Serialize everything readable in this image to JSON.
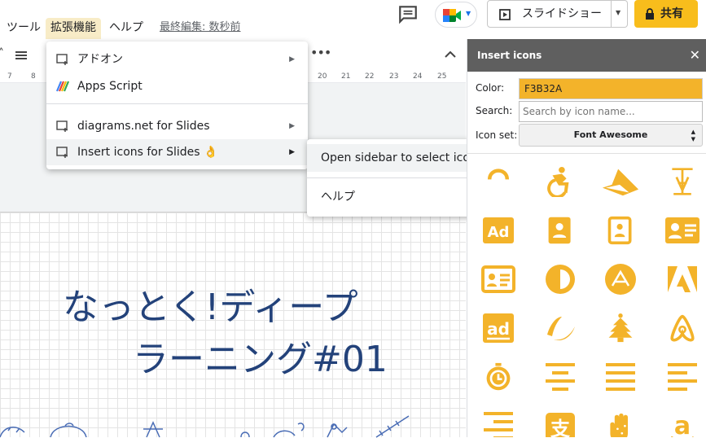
{
  "menubar": {
    "items": [
      "ツール",
      "拡張機能",
      "ヘルプ"
    ],
    "last_edit": "最終編集: 数秒前",
    "slideshow_label": "スライドショー",
    "share_label": "共有"
  },
  "ruler": {
    "numbers": [
      "7",
      "8",
      "20",
      "21",
      "22",
      "23",
      "24",
      "25"
    ]
  },
  "slide": {
    "title_line1": "なっとく!ディープ",
    "title_line2": "ラーニング#01"
  },
  "extensions_menu": {
    "items": [
      {
        "label": "アドオン",
        "has_submenu": true
      },
      {
        "label": "Apps Script",
        "has_submenu": false
      },
      {
        "label": "diagrams.net for Slides",
        "has_submenu": true
      },
      {
        "label": "Insert icons for Slides 👌",
        "has_submenu": true
      }
    ],
    "submenu_arrow": "▶"
  },
  "submenu": {
    "items": [
      "Open sidebar to select icons",
      "ヘルプ"
    ]
  },
  "sidebar": {
    "title": "Insert icons",
    "close": "✕",
    "color_label": "Color:",
    "color_value": "F3B32A",
    "search_label": "Search:",
    "search_placeholder": "Search by icon name...",
    "iconset_label": "Icon set:",
    "iconset_value": "Font Awesome",
    "icon_color": "#f3b32a",
    "icons": [
      "500px-icon",
      "accessible-icon",
      "accusoft-icon",
      "acquisitions-incorporated-icon",
      "ad-icon",
      "address-book-icon",
      "address-book-outline-icon",
      "address-card-icon",
      "address-card-outline-icon",
      "adjust-icon",
      "adn-icon",
      "adobe-icon",
      "adversal-icon",
      "affiliatetheme-icon",
      "air-freshener-icon",
      "airbnb-icon",
      "alarm-clock-icon",
      "align-center-icon",
      "align-justify-icon",
      "align-left-icon",
      "align-right-icon",
      "alipay-icon",
      "allergies-icon",
      "amazon-icon"
    ]
  }
}
